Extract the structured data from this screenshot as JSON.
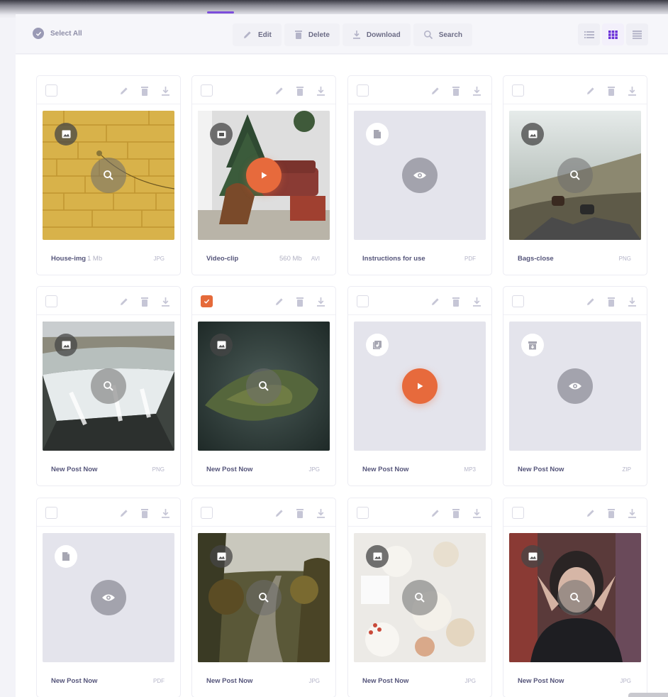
{
  "toolbar": {
    "select_all": "Select All",
    "actions": [
      {
        "label": "Edit",
        "icon": "pencil-icon"
      },
      {
        "label": "Delete",
        "icon": "trash-icon"
      },
      {
        "label": "Download",
        "icon": "download-icon"
      },
      {
        "label": "Search",
        "icon": "search-icon"
      }
    ],
    "views": [
      "list-view-icon",
      "grid-view-icon",
      "table-view-icon"
    ],
    "active_view": "grid-view-icon"
  },
  "colors": {
    "accent": "#7c4ddb",
    "play": "#e76a3c",
    "checked": "#e56a3a"
  },
  "files": [
    {
      "name": "House-img",
      "size": "1 Mb",
      "type": "JPG",
      "kind": "image",
      "action": "zoom",
      "checked": false,
      "preview": "yellow-wall"
    },
    {
      "name": "Video-clip",
      "size": "560 Mb",
      "type": "AVI",
      "kind": "video",
      "action": "play",
      "checked": false,
      "preview": "christmas-room"
    },
    {
      "name": "Instructions for use",
      "size": "",
      "type": "PDF",
      "kind": "document",
      "action": "view",
      "checked": false,
      "preview": "none"
    },
    {
      "name": "Bags-close",
      "size": "",
      "type": "PNG",
      "kind": "image",
      "action": "zoom",
      "checked": false,
      "preview": "cliff-feet"
    },
    {
      "name": "New Post Now",
      "size": "",
      "type": "PNG",
      "kind": "image",
      "action": "zoom",
      "checked": false,
      "preview": "waterfall"
    },
    {
      "name": "New Post Now",
      "size": "",
      "type": "JPG",
      "kind": "image",
      "action": "zoom",
      "checked": true,
      "preview": "island"
    },
    {
      "name": "New Post Now",
      "size": "",
      "type": "MP3",
      "kind": "audio",
      "action": "play",
      "checked": false,
      "preview": "none"
    },
    {
      "name": "New Post Now",
      "size": "",
      "type": "ZIP",
      "kind": "archive",
      "action": "view",
      "checked": false,
      "preview": "none"
    },
    {
      "name": "New Post Now",
      "size": "",
      "type": "PDF",
      "kind": "document",
      "action": "view",
      "checked": false,
      "preview": "none"
    },
    {
      "name": "New Post Now",
      "size": "",
      "type": "JPG",
      "kind": "image",
      "action": "zoom",
      "checked": false,
      "preview": "forest-road"
    },
    {
      "name": "New Post Now",
      "size": "",
      "type": "JPG",
      "kind": "image",
      "action": "zoom",
      "checked": false,
      "preview": "white-sweets"
    },
    {
      "name": "New Post Now",
      "size": "",
      "type": "JPG",
      "kind": "image",
      "action": "zoom",
      "checked": false,
      "preview": "portrait"
    }
  ]
}
